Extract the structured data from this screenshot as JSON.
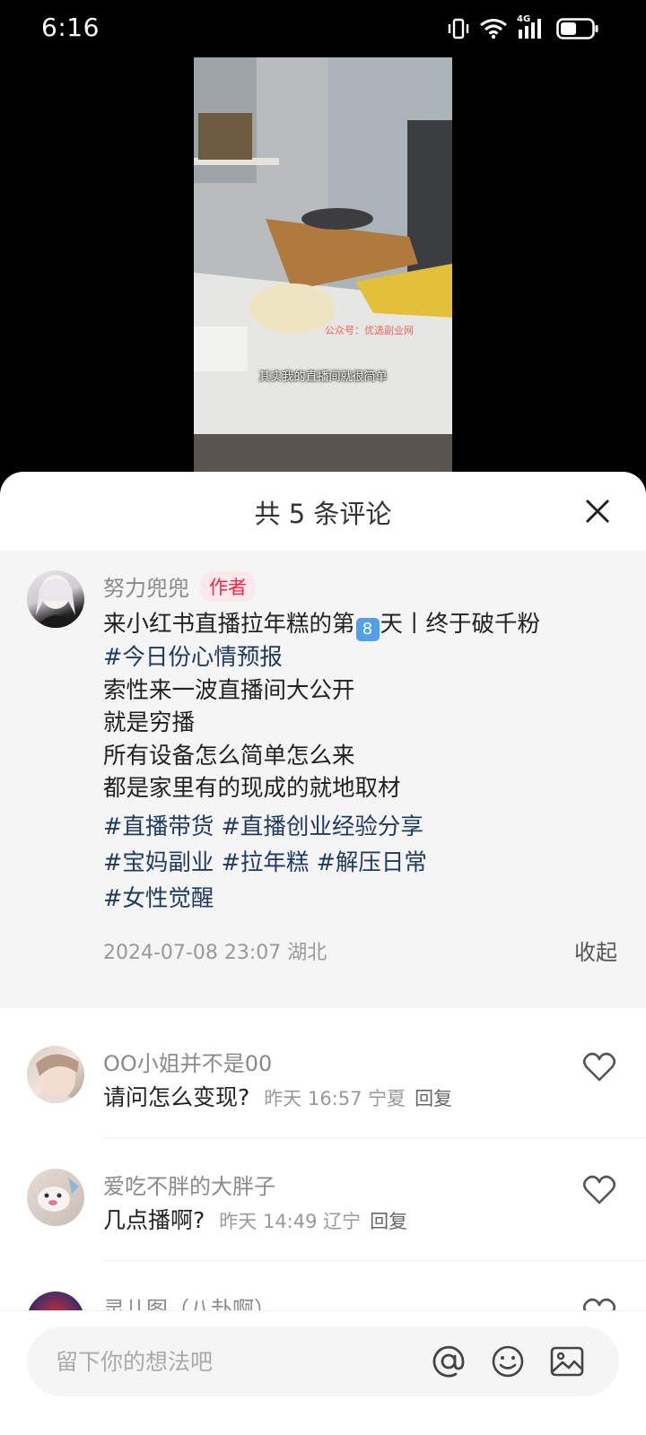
{
  "status_bar": {
    "time": "6:16",
    "network": "4G",
    "icons": [
      "vibrate-icon",
      "wifi-icon",
      "signal-icon",
      "battery-icon"
    ]
  },
  "video": {
    "caption": "其实我的直播间就很简单",
    "watermark": "公众号：优选副业网"
  },
  "sheet": {
    "title": "共 5 条评论"
  },
  "author_post": {
    "username": "努力兜兜",
    "badge": "作者",
    "line1_before": "来小红书直播拉年糕的第",
    "line1_emoji": "8",
    "line1_after": "天丨终于破千粉",
    "hashtag_line": "#今日份心情预报",
    "lines": [
      "索性来一波直播间大公开",
      "就是穷播",
      "所有设备怎么简单怎么来",
      "都是家里有的现成的就地取材"
    ],
    "tags": [
      "#直播带货",
      "#直播创业经验分享",
      "#宝妈副业",
      "#拉年糕",
      "#解压日常",
      "#女性觉醒"
    ],
    "timestamp": "2024-07-08 23:07",
    "location": "湖北",
    "collapse_label": "收起"
  },
  "comments": [
    {
      "username": "OO小姐并不是00",
      "text": "请问怎么变现?",
      "time": "昨天 16:57",
      "location": "宁夏",
      "reply_label": "回复"
    },
    {
      "username": "爱吃不胖的大胖子",
      "text": "几点播啊?",
      "time": "昨天 14:49",
      "location": "辽宁",
      "reply_label": "回复"
    },
    {
      "username": "灵儿图（八卦啊）"
    }
  ],
  "input": {
    "placeholder": "留下你的想法吧"
  },
  "colors": {
    "accent": "#ff2442",
    "hashtag": "#1f3b60",
    "post_bg": "#f5f5f5"
  }
}
